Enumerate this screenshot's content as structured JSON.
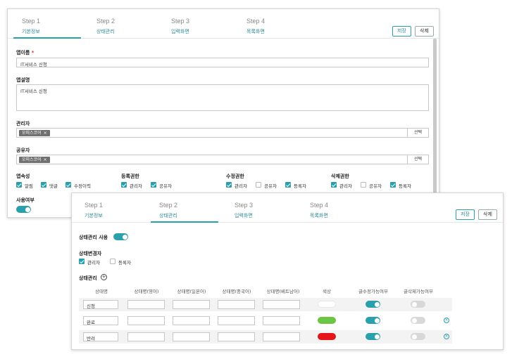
{
  "panel1": {
    "steps": [
      {
        "num": "Step 1",
        "name": "기본정보"
      },
      {
        "num": "Step 2",
        "name": "상태관리"
      },
      {
        "num": "Step 3",
        "name": "입력화면"
      },
      {
        "num": "Step 4",
        "name": "목록화면"
      }
    ],
    "save_label": "저장",
    "delete_label": "삭제",
    "app_name_label": "앱이름",
    "required_mark": "*",
    "app_name_value": "IT서비스 신청",
    "app_desc_label": "앱설명",
    "app_desc_value": "IT서비스 신청",
    "manager_label": "관리자",
    "manager_tag": "오피스코어",
    "sharer_label": "공유자",
    "sharer_tag": "오피스코어",
    "select_label": "선택",
    "tag_remove": "×",
    "groups": [
      {
        "title": "앱속성",
        "items": [
          {
            "label": "알림"
          },
          {
            "label": "댓글"
          },
          {
            "label": "수정이력"
          }
        ]
      },
      {
        "title": "등록권한",
        "items": [
          {
            "label": "관리자"
          },
          {
            "label": "공유자"
          }
        ]
      },
      {
        "title": "수정권한",
        "items": [
          {
            "label": "관리자"
          },
          {
            "label": "공유자"
          },
          {
            "label": "등록자"
          }
        ]
      },
      {
        "title": "삭제권한",
        "items": [
          {
            "label": "관리자"
          },
          {
            "label": "공유자"
          },
          {
            "label": "등록자"
          }
        ]
      }
    ],
    "usage_label": "사용여부"
  },
  "panel2": {
    "steps": [
      {
        "num": "Step 1",
        "name": "기본정보"
      },
      {
        "num": "Step 2",
        "name": "상태관리"
      },
      {
        "num": "Step 3",
        "name": "입력화면"
      },
      {
        "num": "Step 4",
        "name": "목록화면"
      }
    ],
    "save_label": "저장",
    "delete_label": "삭제",
    "state_use_label": "상태관리 사용",
    "changer_label": "상태변경자",
    "changer_items": [
      {
        "label": "관리자"
      },
      {
        "label": "등록자"
      }
    ],
    "state_mgmt_label": "상태관리",
    "headers": [
      "상태명",
      "상태명(영어)",
      "상태명(일본어)",
      "상태명(중국어)",
      "상태명(베트남어)",
      "색상",
      "글수정가능여부",
      "글삭제가능여부"
    ],
    "rows": [
      {
        "name": "신청",
        "color": "#ffffff"
      },
      {
        "name": "완료",
        "color": "#6cc644"
      },
      {
        "name": "반려",
        "color": "#e8141c"
      }
    ]
  }
}
